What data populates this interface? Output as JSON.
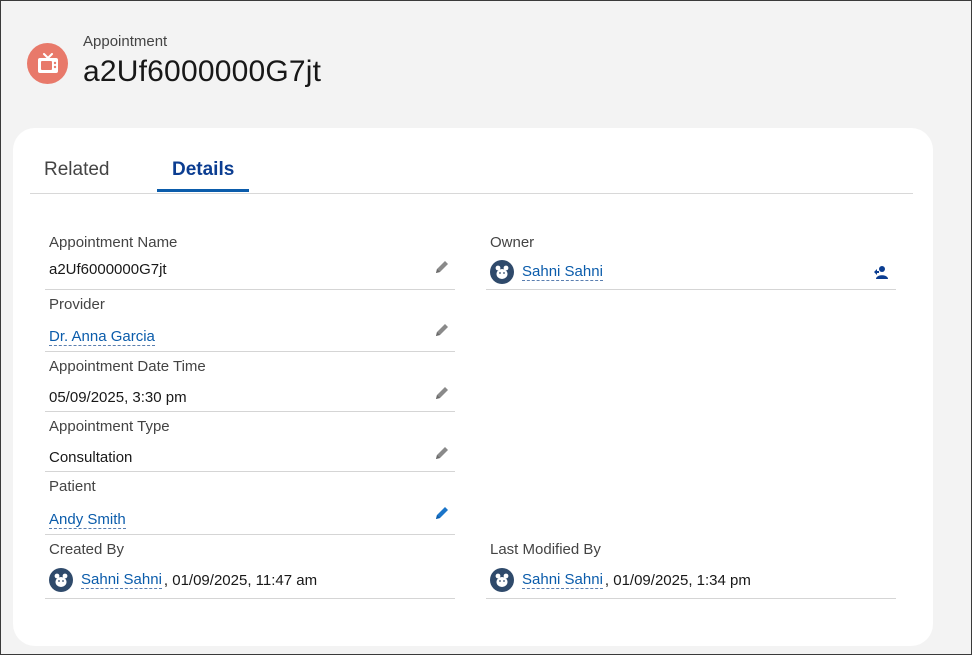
{
  "header": {
    "object_label": "Appointment",
    "record_title": "a2Uf6000000G7jt",
    "icon": "tv-icon",
    "icon_color": "#e8796a"
  },
  "tabs": [
    {
      "label": "Related",
      "active": false
    },
    {
      "label": "Details",
      "active": true
    }
  ],
  "fields": {
    "appointment_name": {
      "label": "Appointment Name",
      "value": "a2Uf6000000G7jt"
    },
    "provider": {
      "label": "Provider",
      "value": "Dr. Anna Garcia"
    },
    "appointment_date_time": {
      "label": "Appointment Date Time",
      "value": "05/09/2025, 3:30 pm"
    },
    "appointment_type": {
      "label": "Appointment Type",
      "value": "Consultation"
    },
    "patient": {
      "label": "Patient",
      "value": "Andy Smith"
    },
    "created_by": {
      "label": "Created By",
      "user": "Sahni Sahni",
      "timestamp": ", 01/09/2025, 11:47 am"
    },
    "owner": {
      "label": "Owner",
      "user": "Sahni Sahni"
    },
    "last_modified_by": {
      "label": "Last Modified By",
      "user": "Sahni Sahni",
      "timestamp": ", 01/09/2025, 1:34 pm"
    }
  },
  "colors": {
    "link": "#0b5cab",
    "active_tab": "#0b3d91",
    "avatar_bg": "#2f4a6b"
  }
}
